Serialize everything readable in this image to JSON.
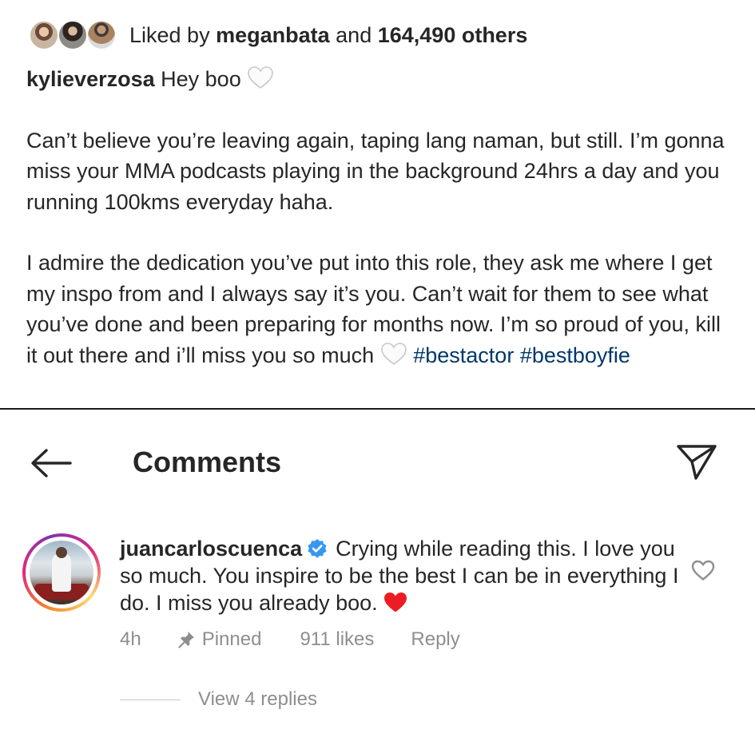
{
  "post": {
    "liked_by_prefix": "Liked by",
    "liked_by_user": "meganbata",
    "liked_by_and": "and",
    "liked_by_others": "164,490 others",
    "caption_user": "kylieverzosa",
    "caption_greeting": "Hey boo",
    "caption_para1": "Can’t believe you’re leaving again, taping lang naman, but still. I’m gonna miss your MMA podcasts playing in the background 24hrs a day and you running 100kms everyday haha.",
    "caption_para2": "I admire the dedication you’ve put into this role, they ask me where I get my inspo from and I always say it’s you. Can’t wait for them to see what you’ve done and been preparing for months now. I’m so proud of you, kill it out there and i’ll miss you so much",
    "hashtag_1": "#bestactor",
    "hashtag_2": "#bestboyfie"
  },
  "header": {
    "title": "Comments",
    "back_icon": "arrow-left-icon",
    "send_icon": "paper-plane-icon"
  },
  "comment": {
    "username": "juancarloscuenca",
    "text": "Crying while reading this. I love you so much. You inspire to be the best I can be in everything I do. I miss you already boo.",
    "time": "4h",
    "pinned_label": "Pinned",
    "likes": "911 likes",
    "reply_label": "Reply",
    "view_replies": "View 4 replies"
  },
  "colors": {
    "text": "#262626",
    "secondary": "#8e8e8e",
    "hashtag": "#00376b",
    "verified": "#3897f0",
    "heart_red": "#ed1c24"
  }
}
